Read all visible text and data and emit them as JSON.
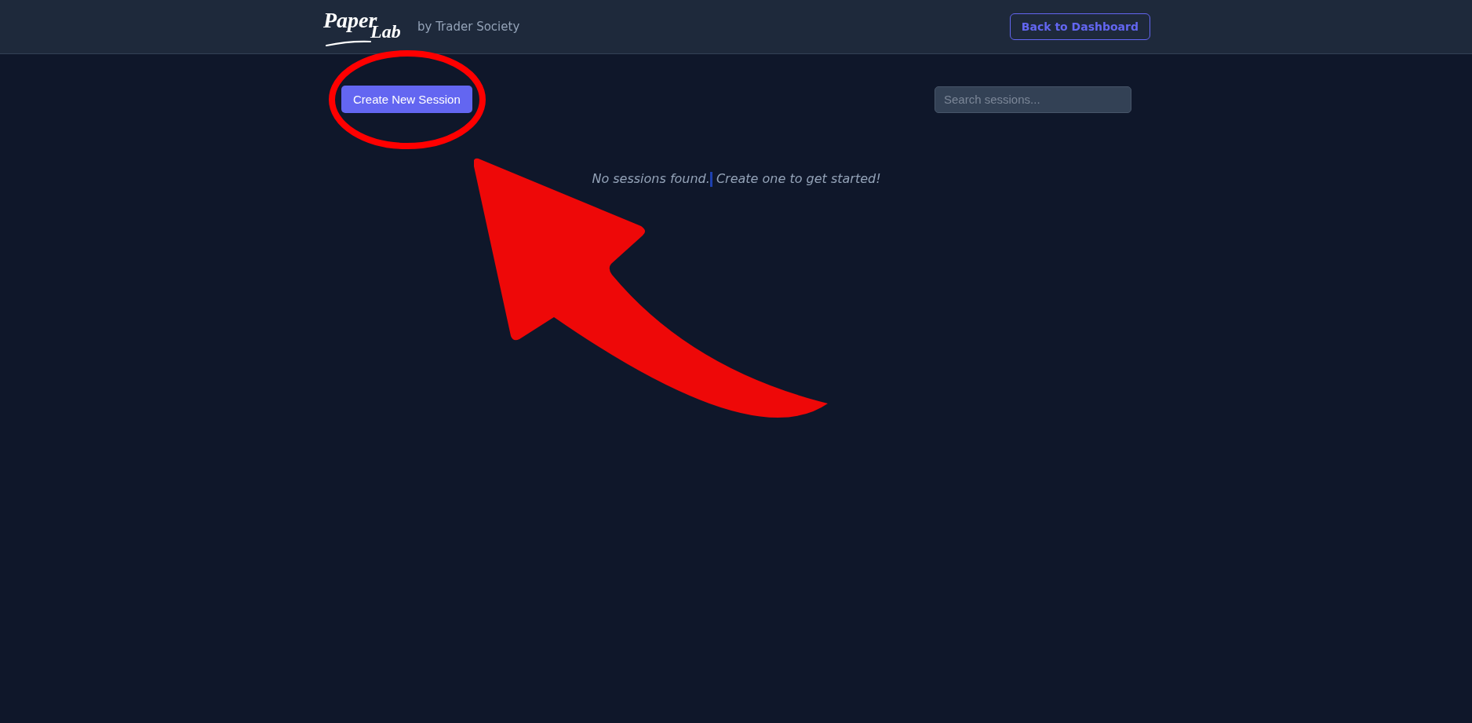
{
  "header": {
    "logo": {
      "words": [
        "Paper",
        "Lab"
      ],
      "tagline": "by Trader Society"
    },
    "back_button": "Back to Dashboard"
  },
  "toolbar": {
    "create_button": "Create New Session",
    "search": {
      "placeholder": "Search sessions..."
    }
  },
  "empty_message": {
    "before": "No sessions found.",
    "after": "Create one to get started!"
  },
  "annotations": [
    {
      "kind": "ellipse",
      "color": "#ff0000"
    },
    {
      "kind": "arrow",
      "color": "#ee0808"
    }
  ]
}
